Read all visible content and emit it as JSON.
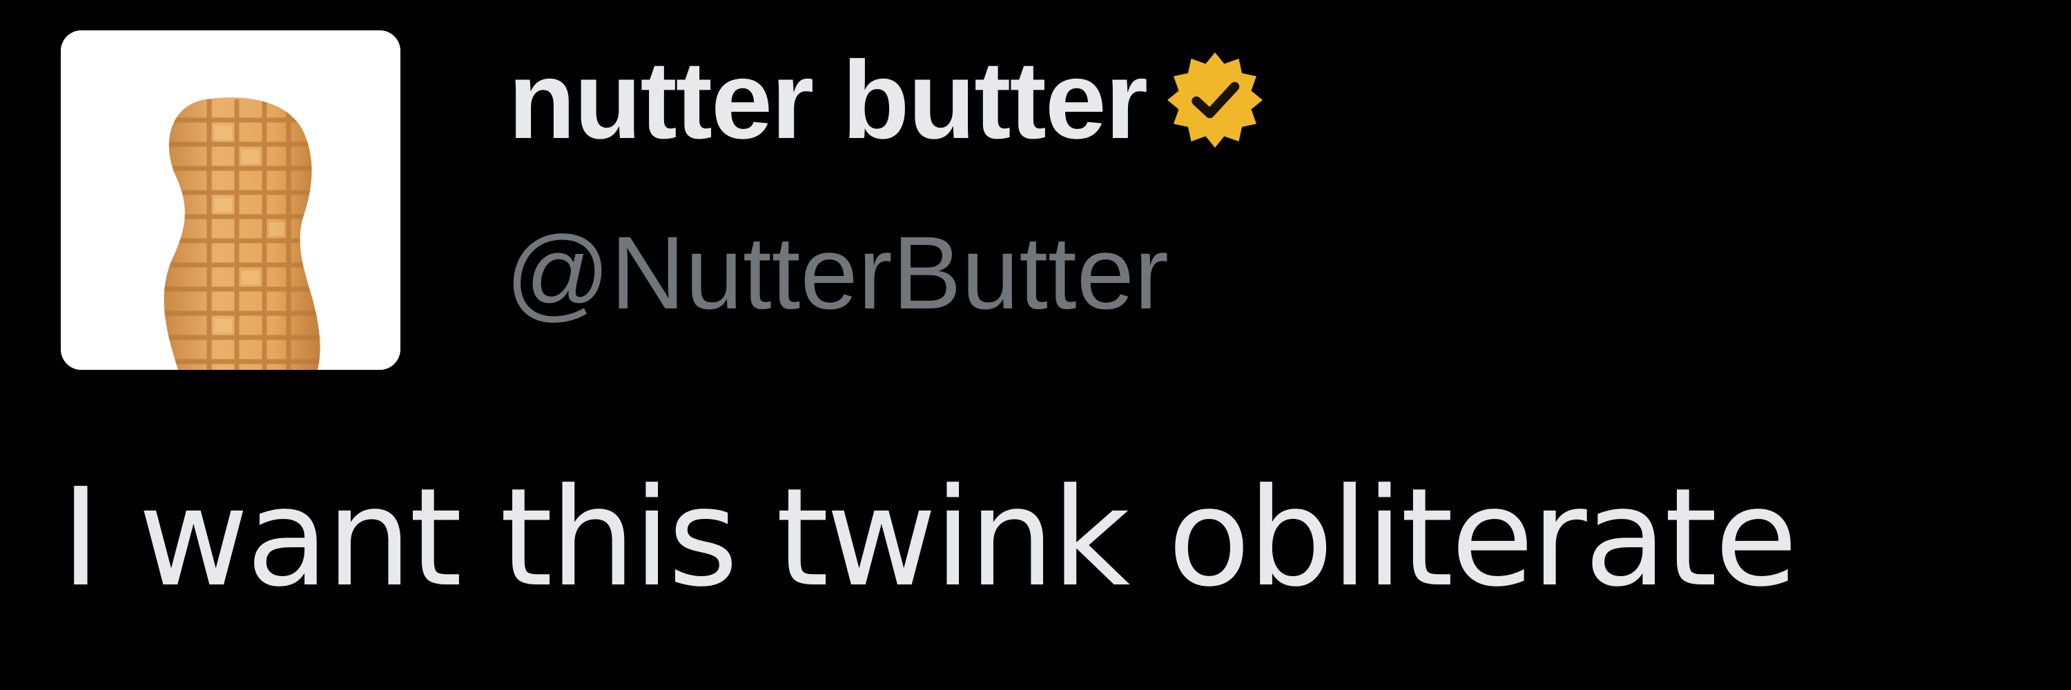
{
  "tweet": {
    "author": {
      "display_name": "nutter butter",
      "handle": "@NutterButter",
      "verified": true,
      "verified_badge_color": "#f0b72a",
      "avatar_icon": "peanut-cookie-icon"
    },
    "text": "I want this twink obliterate"
  },
  "colors": {
    "background": "#000000",
    "primary_text": "#e7e9ea",
    "secondary_text": "#71767b",
    "avatar_background": "#ffffff",
    "cookie": "#e3a55c"
  }
}
